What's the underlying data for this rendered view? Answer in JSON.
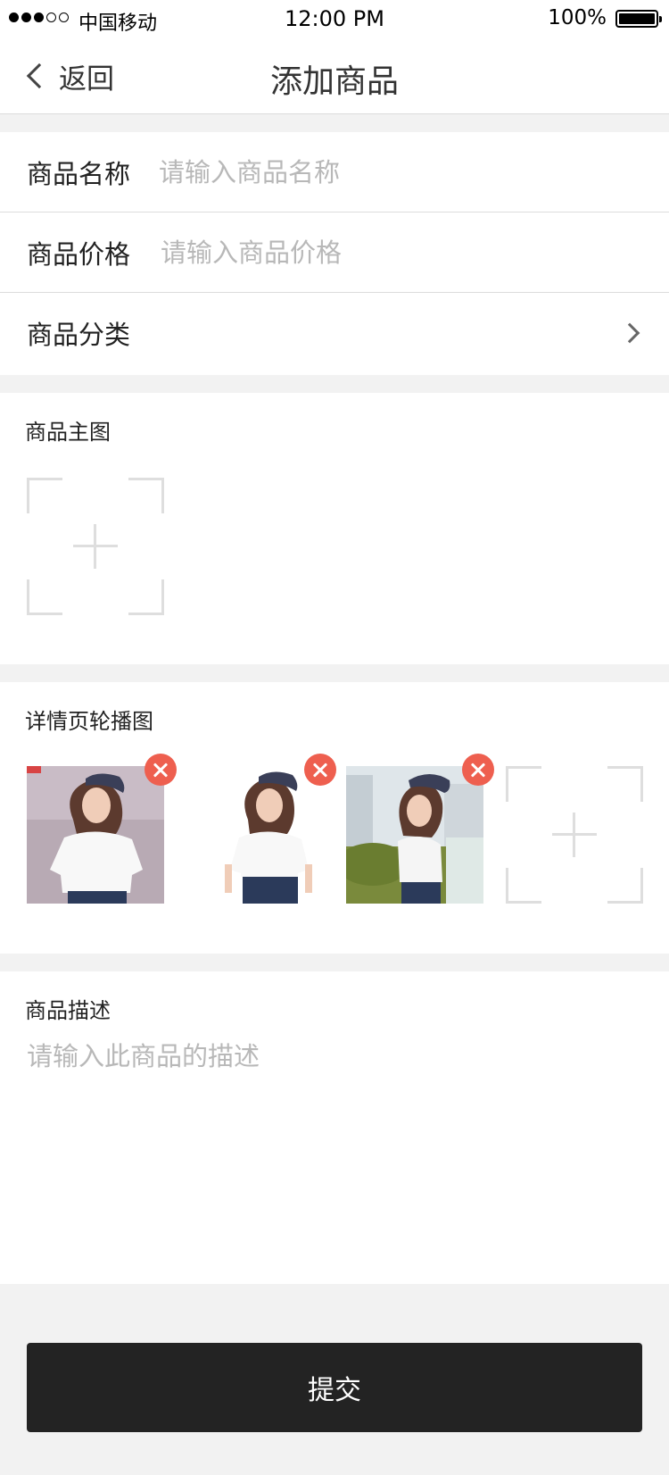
{
  "status_bar": {
    "carrier": "中国移动",
    "time": "12:00 PM",
    "battery_text": "100%",
    "battery_level": 1.0,
    "signal_strength": 3,
    "signal_max": 5
  },
  "nav": {
    "back_label": "返回",
    "title": "添加商品"
  },
  "form": {
    "name": {
      "label": "商品名称",
      "placeholder": "请输入商品名称",
      "value": ""
    },
    "price": {
      "label": "商品价格",
      "placeholder": "请输入商品价格",
      "value": ""
    },
    "category": {
      "label": "商品分类",
      "value": ""
    }
  },
  "main_image": {
    "title": "商品主图"
  },
  "carousel": {
    "title": "详情页轮播图",
    "image_count": 3
  },
  "description": {
    "title": "商品描述",
    "placeholder": "请输入此商品的描述",
    "value": ""
  },
  "submit": {
    "label": "提交"
  },
  "colors": {
    "accent_remove": "#ee5f4f",
    "submit_bg": "#232323",
    "page_bg": "#f2f2f2",
    "placeholder": "#b8b8b8"
  }
}
